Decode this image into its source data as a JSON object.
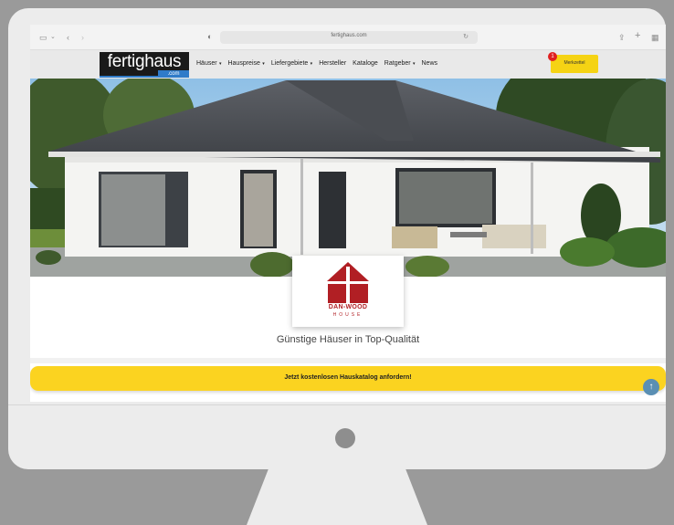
{
  "browser": {
    "url": "fertighaus.com",
    "icons": [
      "sidebar-icon",
      "chevron-left-icon",
      "chevron-right-icon",
      "shield-icon",
      "share-icon",
      "new-tab-icon",
      "tab-overview-icon"
    ]
  },
  "site": {
    "logo": {
      "main": "fertighaus",
      "sub": ".com"
    },
    "nav": [
      {
        "label": "Häuser",
        "dropdown": true
      },
      {
        "label": "Hauspreise",
        "dropdown": true
      },
      {
        "label": "Liefergebiete",
        "dropdown": true
      },
      {
        "label": "Hersteller",
        "dropdown": false
      },
      {
        "label": "Kataloge",
        "dropdown": false
      },
      {
        "label": "Ratgeber",
        "dropdown": true
      },
      {
        "label": "News",
        "dropdown": false
      }
    ],
    "wishlist": {
      "label": "Merkzettel",
      "count": "1"
    },
    "colors": {
      "accent_yellow": "#fbd320",
      "brand_red": "#b11f24",
      "logo_blue": "#2f7bc9"
    }
  },
  "brand": {
    "name": "DAN-WOOD",
    "sub": "HOUSE",
    "tagline": "Günstige Häuser in Top-Qualität"
  },
  "cta": {
    "label": "Jetzt kostenlosen Hauskatalog anfordern!"
  }
}
